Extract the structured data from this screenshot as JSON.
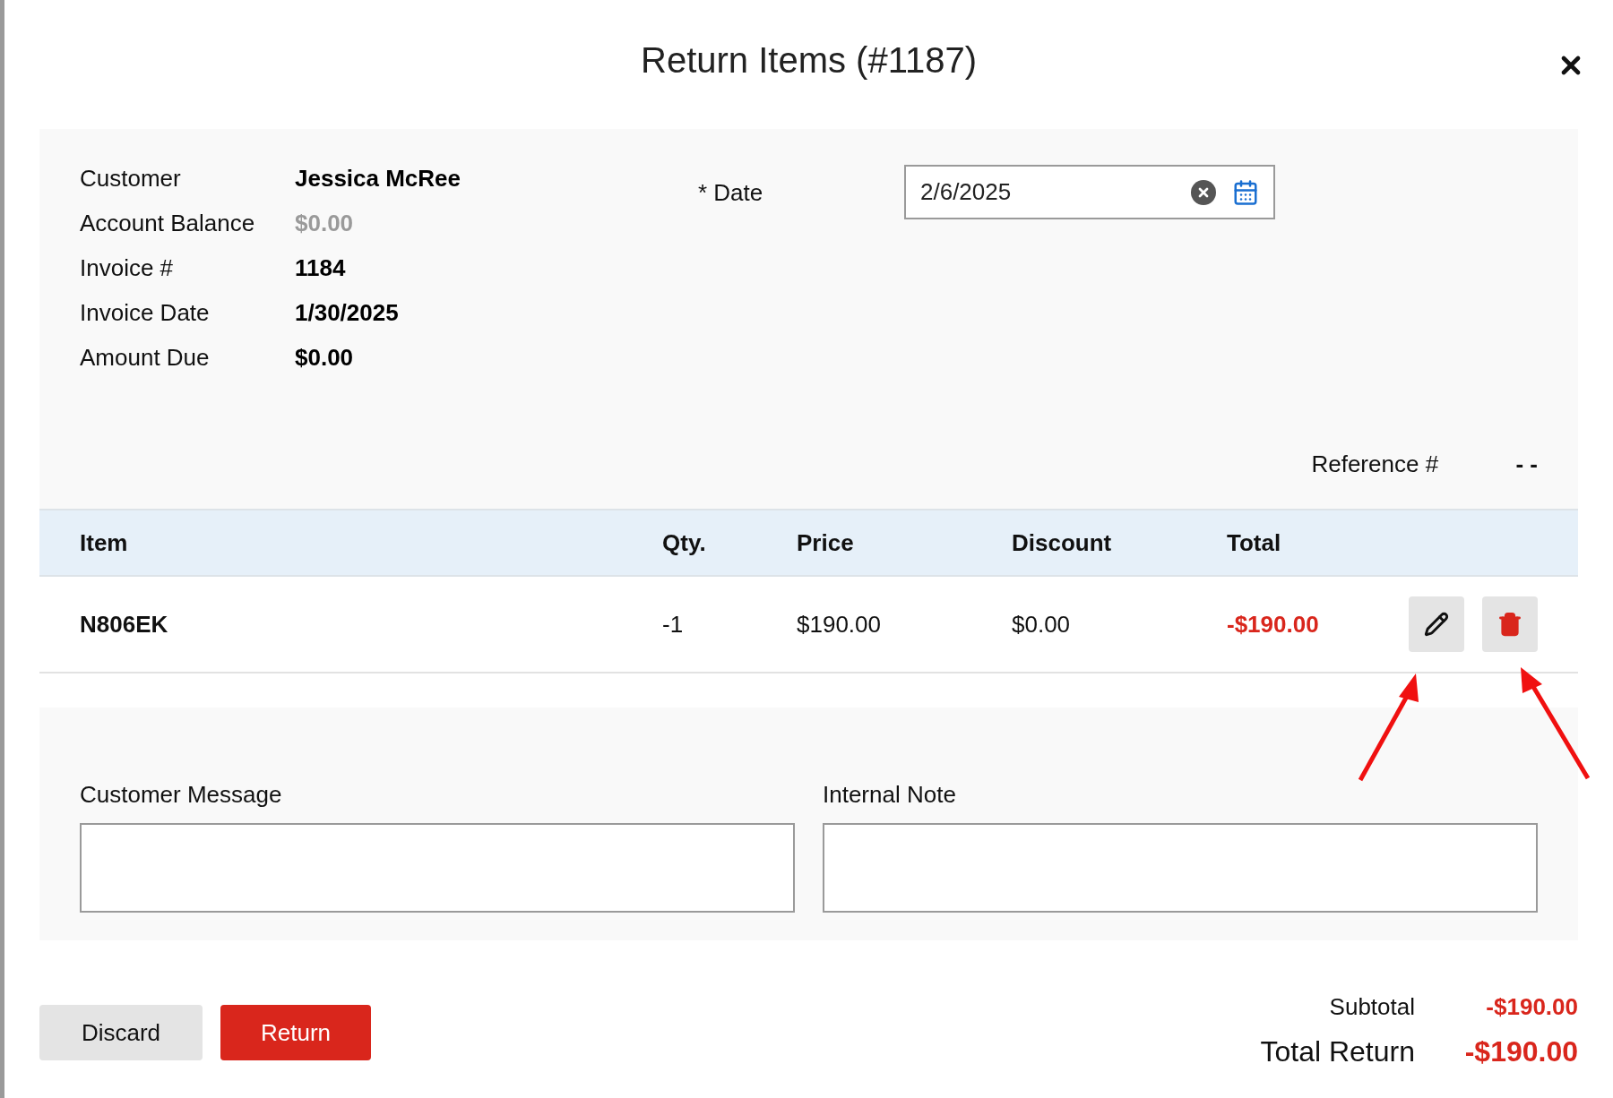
{
  "dialog": {
    "title": "Return Items (#1187)"
  },
  "details": [
    {
      "label": "Customer",
      "value": "Jessica McRee",
      "muted": false
    },
    {
      "label": "Account Balance",
      "value": "$0.00",
      "muted": true
    },
    {
      "label": "Invoice #",
      "value": "1184",
      "muted": false
    },
    {
      "label": "Invoice Date",
      "value": "1/30/2025",
      "muted": false
    },
    {
      "label": "Amount Due",
      "value": "$0.00",
      "muted": false
    }
  ],
  "date": {
    "label": "* Date",
    "value": "2/6/2025"
  },
  "reference": {
    "label": "Reference #",
    "value": "- -"
  },
  "table": {
    "columns": [
      "Item",
      "Qty.",
      "Price",
      "Discount",
      "Total"
    ],
    "rows": [
      {
        "item": "N806EK",
        "qty": "-1",
        "price": "$190.00",
        "discount": "$0.00",
        "total": "-$190.00"
      }
    ]
  },
  "notes": [
    {
      "label": "Customer Message"
    },
    {
      "label": "Internal Note"
    }
  ],
  "buttons": [
    {
      "label": "Discard",
      "kind": "secondary"
    },
    {
      "label": "Return",
      "kind": "primary"
    }
  ],
  "totals": [
    {
      "label": "Subtotal",
      "value": "-$190.00",
      "kind": "subtotal"
    },
    {
      "label": "Total Return",
      "value": "-$190.00",
      "kind": "grand"
    }
  ]
}
